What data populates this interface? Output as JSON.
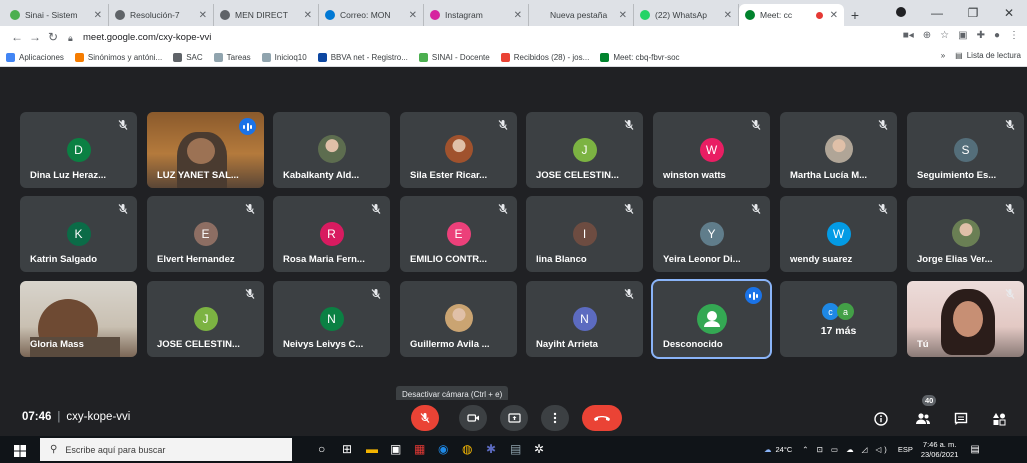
{
  "browser": {
    "tabs": [
      {
        "title": "Sinai - Sistem",
        "favicon": "#4caf50",
        "active": false
      },
      {
        "title": "Resolución-7",
        "favicon": "#5f6368",
        "active": false
      },
      {
        "title": "MEN DIRECT",
        "favicon": "#5f6368",
        "active": false
      },
      {
        "title": "Correo: MON",
        "favicon": "#0078d4",
        "active": false
      },
      {
        "title": "Instagram",
        "favicon": "#d6249f",
        "active": false
      },
      {
        "title": "Nueva pestaña",
        "favicon": "#dee1e6",
        "active": false
      },
      {
        "title": "(22) WhatsAp",
        "favicon": "#25d366",
        "active": false
      },
      {
        "title": "Meet: cc",
        "favicon": "#00832d",
        "active": true
      }
    ],
    "url": "meet.google.com/cxy-kope-vvi",
    "bookmarks": [
      {
        "label": "Aplicaciones",
        "color": "#4285f4"
      },
      {
        "label": "Sinónimos y antóni...",
        "color": "#f57c00"
      },
      {
        "label": "SAC",
        "color": "#5f6368"
      },
      {
        "label": "Tareas",
        "color": "#90a4ae"
      },
      {
        "label": "Inicioq10",
        "color": "#90a4ae"
      },
      {
        "label": "BBVA net - Registro...",
        "color": "#0d47a1"
      },
      {
        "label": "SINAI - Docente",
        "color": "#4caf50"
      },
      {
        "label": "Recibidos (28) - jos...",
        "color": "#ea4335"
      },
      {
        "label": "Meet: cbq-fbvr-soc",
        "color": "#00832d"
      }
    ],
    "reading_list": "Lista de lectura",
    "more_bookmarks": "»"
  },
  "meet": {
    "tiles": [
      {
        "name": "Dina Luz Heraz...",
        "kind": "avatar",
        "letter": "D",
        "color": "#0b8043",
        "muted": true
      },
      {
        "name": "LUZ YANET SAL...",
        "kind": "video",
        "scene": "luz",
        "speaking": true
      },
      {
        "name": "Kabalkanty Ald...",
        "kind": "photo",
        "photo": "#5d6d4f",
        "muted": false
      },
      {
        "name": "Sila Ester Ricar...",
        "kind": "photo",
        "photo": "#a0522d",
        "muted": true
      },
      {
        "name": "JOSE CELESTIN...",
        "kind": "avatar",
        "letter": "J",
        "color": "#7cb342",
        "muted": true
      },
      {
        "name": "winston watts",
        "kind": "avatar",
        "letter": "W",
        "color": "#e91e63",
        "muted": true
      },
      {
        "name": "Martha Lucía M...",
        "kind": "photo",
        "photo": "#b0a597",
        "muted": true
      },
      {
        "name": "Seguimiento Es...",
        "kind": "avatar",
        "letter": "S",
        "color": "#546e7a",
        "muted": true
      },
      {
        "name": "Katrin Salgado",
        "kind": "avatar",
        "letter": "K",
        "color": "#0b6b47",
        "muted": true
      },
      {
        "name": "Elvert Hernandez",
        "kind": "avatar",
        "letter": "E",
        "color": "#8d6e63",
        "muted": true
      },
      {
        "name": "Rosa Maria Fern...",
        "kind": "avatar",
        "letter": "R",
        "color": "#d81b60",
        "muted": true
      },
      {
        "name": "EMILIO CONTR...",
        "kind": "avatar",
        "letter": "E",
        "color": "#ec407a",
        "muted": true
      },
      {
        "name": "lina Blanco",
        "kind": "avatar",
        "letter": "I",
        "color": "#6d4c41",
        "muted": true
      },
      {
        "name": "Yeira Leonor Di...",
        "kind": "avatar",
        "letter": "Y",
        "color": "#607d8b",
        "muted": true
      },
      {
        "name": "wendy suarez",
        "kind": "avatar",
        "letter": "W",
        "color": "#039be5",
        "muted": true
      },
      {
        "name": "Jorge Elias Ver...",
        "kind": "photo",
        "photo": "#6a7f54",
        "muted": true
      },
      {
        "name": "Gloria Mass",
        "kind": "video",
        "scene": "gloria",
        "muted": false
      },
      {
        "name": "JOSE CELESTIN...",
        "kind": "avatar",
        "letter": "J",
        "color": "#7cb342",
        "muted": true
      },
      {
        "name": "Neivys Leivys C...",
        "kind": "avatar",
        "letter": "N",
        "color": "#0b8043",
        "muted": true
      },
      {
        "name": "Guillermo Avila ...",
        "kind": "photo",
        "photo": "#caa472",
        "muted": false
      },
      {
        "name": "Nayiht Arrieta",
        "kind": "avatar",
        "letter": "N",
        "color": "#5c6bc0",
        "muted": true
      },
      {
        "name": "Desconocido",
        "kind": "unknown",
        "speaking": true,
        "selected": true
      },
      {
        "name": "17 más",
        "kind": "more",
        "minis": [
          {
            "letter": "c",
            "color": "#1e88e5"
          },
          {
            "letter": "a",
            "color": "#43a047"
          }
        ]
      },
      {
        "name": "Tú",
        "kind": "video",
        "scene": "you",
        "muted": true
      }
    ],
    "tooltip": "Desactivar cámara (Ctrl + e)",
    "time": "07:46",
    "meeting_code": "cxy-kope-vvi",
    "participants_count": "40",
    "colors": {
      "accent": "#1a73e8",
      "end_call": "#ea4335",
      "tile": "#3c4043",
      "background": "#202124"
    }
  },
  "taskbar": {
    "search_placeholder": "Escribe aquí para buscar",
    "temperature": "24°C",
    "language": "ESP",
    "time": "7:46 a. m.",
    "date": "23/06/2021"
  }
}
